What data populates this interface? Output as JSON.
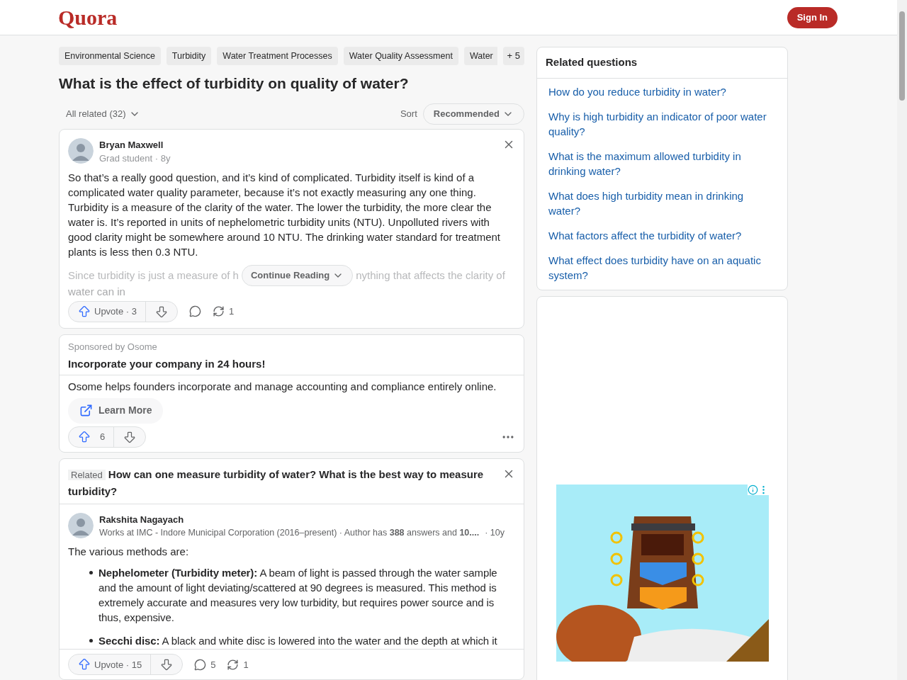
{
  "header": {
    "logo": "Quora",
    "sign_in": "Sign In"
  },
  "question": {
    "topics": [
      "Environmental Science",
      "Turbidity",
      "Water Treatment Processes",
      "Water Quality Assessment",
      "Water"
    ],
    "more_topics": "+ 5",
    "title": "What is the effect of turbidity on quality of water?",
    "filter": "All related (32)",
    "sort_label": "Sort",
    "sort_value": "Recommended"
  },
  "feed": [
    {
      "kind": "answer",
      "author": "Bryan Maxwell",
      "credential": "Grad student · 8y",
      "paragraphs": [
        "So that’s a really good question, and it’s kind of complicated. Turbidity itself is kind of a complicated water quality parameter, because it’s not exactly measuring any one thing. Turbidity is a measure of the clarity of the water. The lower the turbidity, the more clear the water is. It’s reported in units of nephelometric turbidity units (NTU). Unpolluted rivers with good clarity might be somewhere around 10 NTU. The drinking water standard for treatment plants is less then 0.3 NTU."
      ],
      "faded_left": "Since turbidity is just a measure of h",
      "faded_right": "nything that affects the clarity of",
      "faded_tail": "water can in",
      "continue": "Continue Reading",
      "upvote": "Upvote · 3",
      "shares": "1"
    },
    {
      "kind": "ad",
      "sponsor": "Sponsored by Osome",
      "headline": "Incorporate your company in 24 hours!",
      "body": "Osome helps founders incorporate and manage accounting and compliance entirely online.",
      "cta": "Learn More",
      "upvotes": "6"
    },
    {
      "kind": "related_answer",
      "tag": "Related",
      "question": "How can one measure turbidity of water? What is the best way to measure turbidity?",
      "author": "Rakshita Nagayach",
      "credential": "Works at IMC - Indore Municipal Corporation (2016–present) · Author has **388** answers and **10....**",
      "age": "· 10y",
      "intro": "The various methods are:",
      "bullets": [
        {
          "term": "Nephelometer (Turbidity meter):",
          "text": "A beam of light is passed through the water sample and the amount of light deviating/scattered at 90 degrees is measured. This method is extremely accurate and measures very low turbidity, but requires power source and is thus, expensive."
        },
        {
          "term": "Secchi disc:",
          "text": "A black and white disc is lowered into the water and the depth at which it"
        }
      ],
      "upvote": "Upvote · 15",
      "comments": "5",
      "shares": "1"
    }
  ],
  "related": {
    "title": "Related questions",
    "questions": [
      "How do you reduce turbidity in water?",
      "Why is high turbidity an indicator of poor water quality?",
      "What is the maximum allowed turbidity in drinking water?",
      "What does high turbidity mean in drinking water?",
      "What factors affect the turbidity of water?",
      "What effect does turbidity have on an aquatic system?"
    ]
  }
}
